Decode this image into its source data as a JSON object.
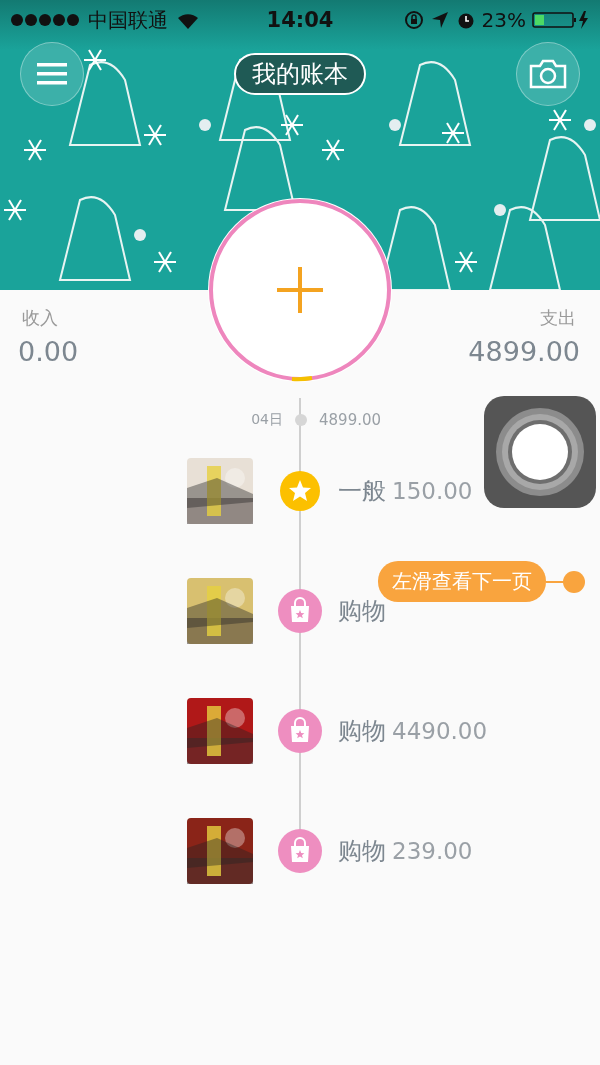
{
  "status_bar": {
    "carrier": "中国联通",
    "time": "14:04",
    "battery": "23%"
  },
  "header": {
    "title": "我的账本"
  },
  "summary": {
    "income_label": "收入",
    "income": "0.00",
    "expense_label": "支出",
    "expense": "4899.00"
  },
  "day": {
    "date": "04日",
    "total": "4899.00"
  },
  "entries": [
    {
      "kind": "general",
      "category": "一般",
      "amount": "150.00"
    },
    {
      "kind": "shopping",
      "category": "购物"
    },
    {
      "kind": "shopping",
      "category": "购物",
      "amount": "4490.00"
    },
    {
      "kind": "shopping",
      "category": "购物",
      "amount": "239.00"
    }
  ],
  "tooltip": {
    "text": "左滑查看下一页"
  }
}
